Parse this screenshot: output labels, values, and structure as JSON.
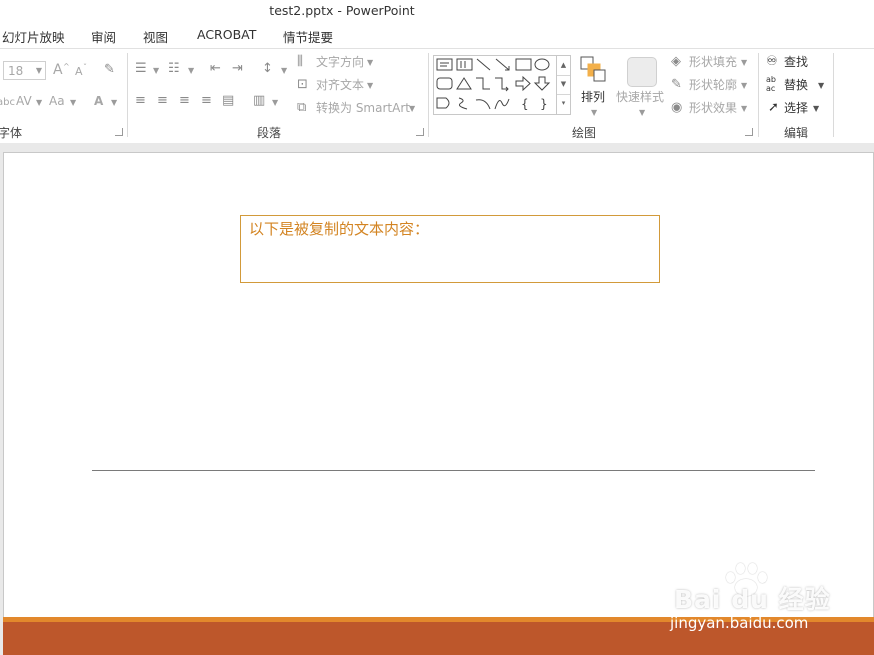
{
  "window": {
    "title": "test2.pptx - PowerPoint"
  },
  "tabs": [
    "幻灯片放映",
    "审阅",
    "视图",
    "ACROBAT",
    "情节提要"
  ],
  "ribbon": {
    "font_group": {
      "label": "字体",
      "font_size": "18",
      "grow_font": "A",
      "shrink_font": "A",
      "char_spacing": "AV",
      "change_case": "Aa",
      "font_color": "A"
    },
    "paragraph_group": {
      "label": "段落",
      "text_direction": "文字方向",
      "align_text": "对齐文本",
      "convert_smartart": "转换为 SmartArt"
    },
    "drawing_group": {
      "label": "绘图",
      "arrange": "排列",
      "quick_styles": "快速样式",
      "shape_fill": "形状填充",
      "shape_outline": "形状轮廓",
      "shape_effects": "形状效果"
    },
    "editing_group": {
      "label": "编辑",
      "find": "查找",
      "replace": "替换",
      "select": "选择"
    }
  },
  "slide": {
    "textbox_text": "以下是被复制的文本内容："
  },
  "watermark": {
    "logo": "Bai du 经验",
    "url": "jingyan.baidu.com"
  },
  "colors": {
    "accent": "#bd572b",
    "accent_stripe": "#e2882c",
    "text_orange": "#d38422",
    "textbox_border": "#d29a3a"
  }
}
